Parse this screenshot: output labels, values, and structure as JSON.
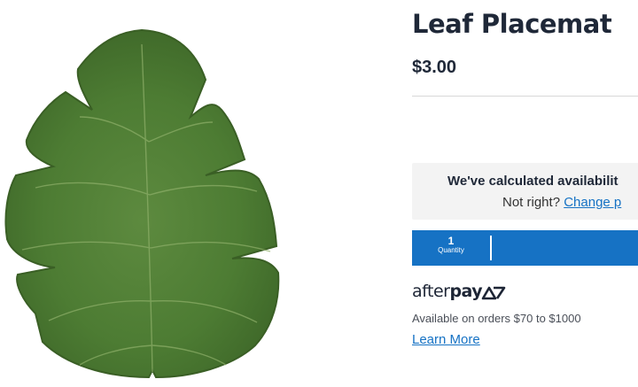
{
  "product": {
    "title": "Leaf Placemat",
    "price": "$3.00",
    "image_icon": "monstera-leaf-image"
  },
  "availability": {
    "message": "We've calculated availabilit",
    "prompt": "Not right?",
    "change_link": "Change p"
  },
  "quantity": {
    "value": "1",
    "label": "Quantity"
  },
  "afterpay": {
    "logo_regular": "after",
    "logo_bold": "pay",
    "description": "Available on orders $70 to $1000",
    "learn_more": "Learn More"
  },
  "colors": {
    "accent_blue": "#1672c4",
    "leaf_green": "#4f7f36",
    "text_dark": "#1f2838"
  }
}
